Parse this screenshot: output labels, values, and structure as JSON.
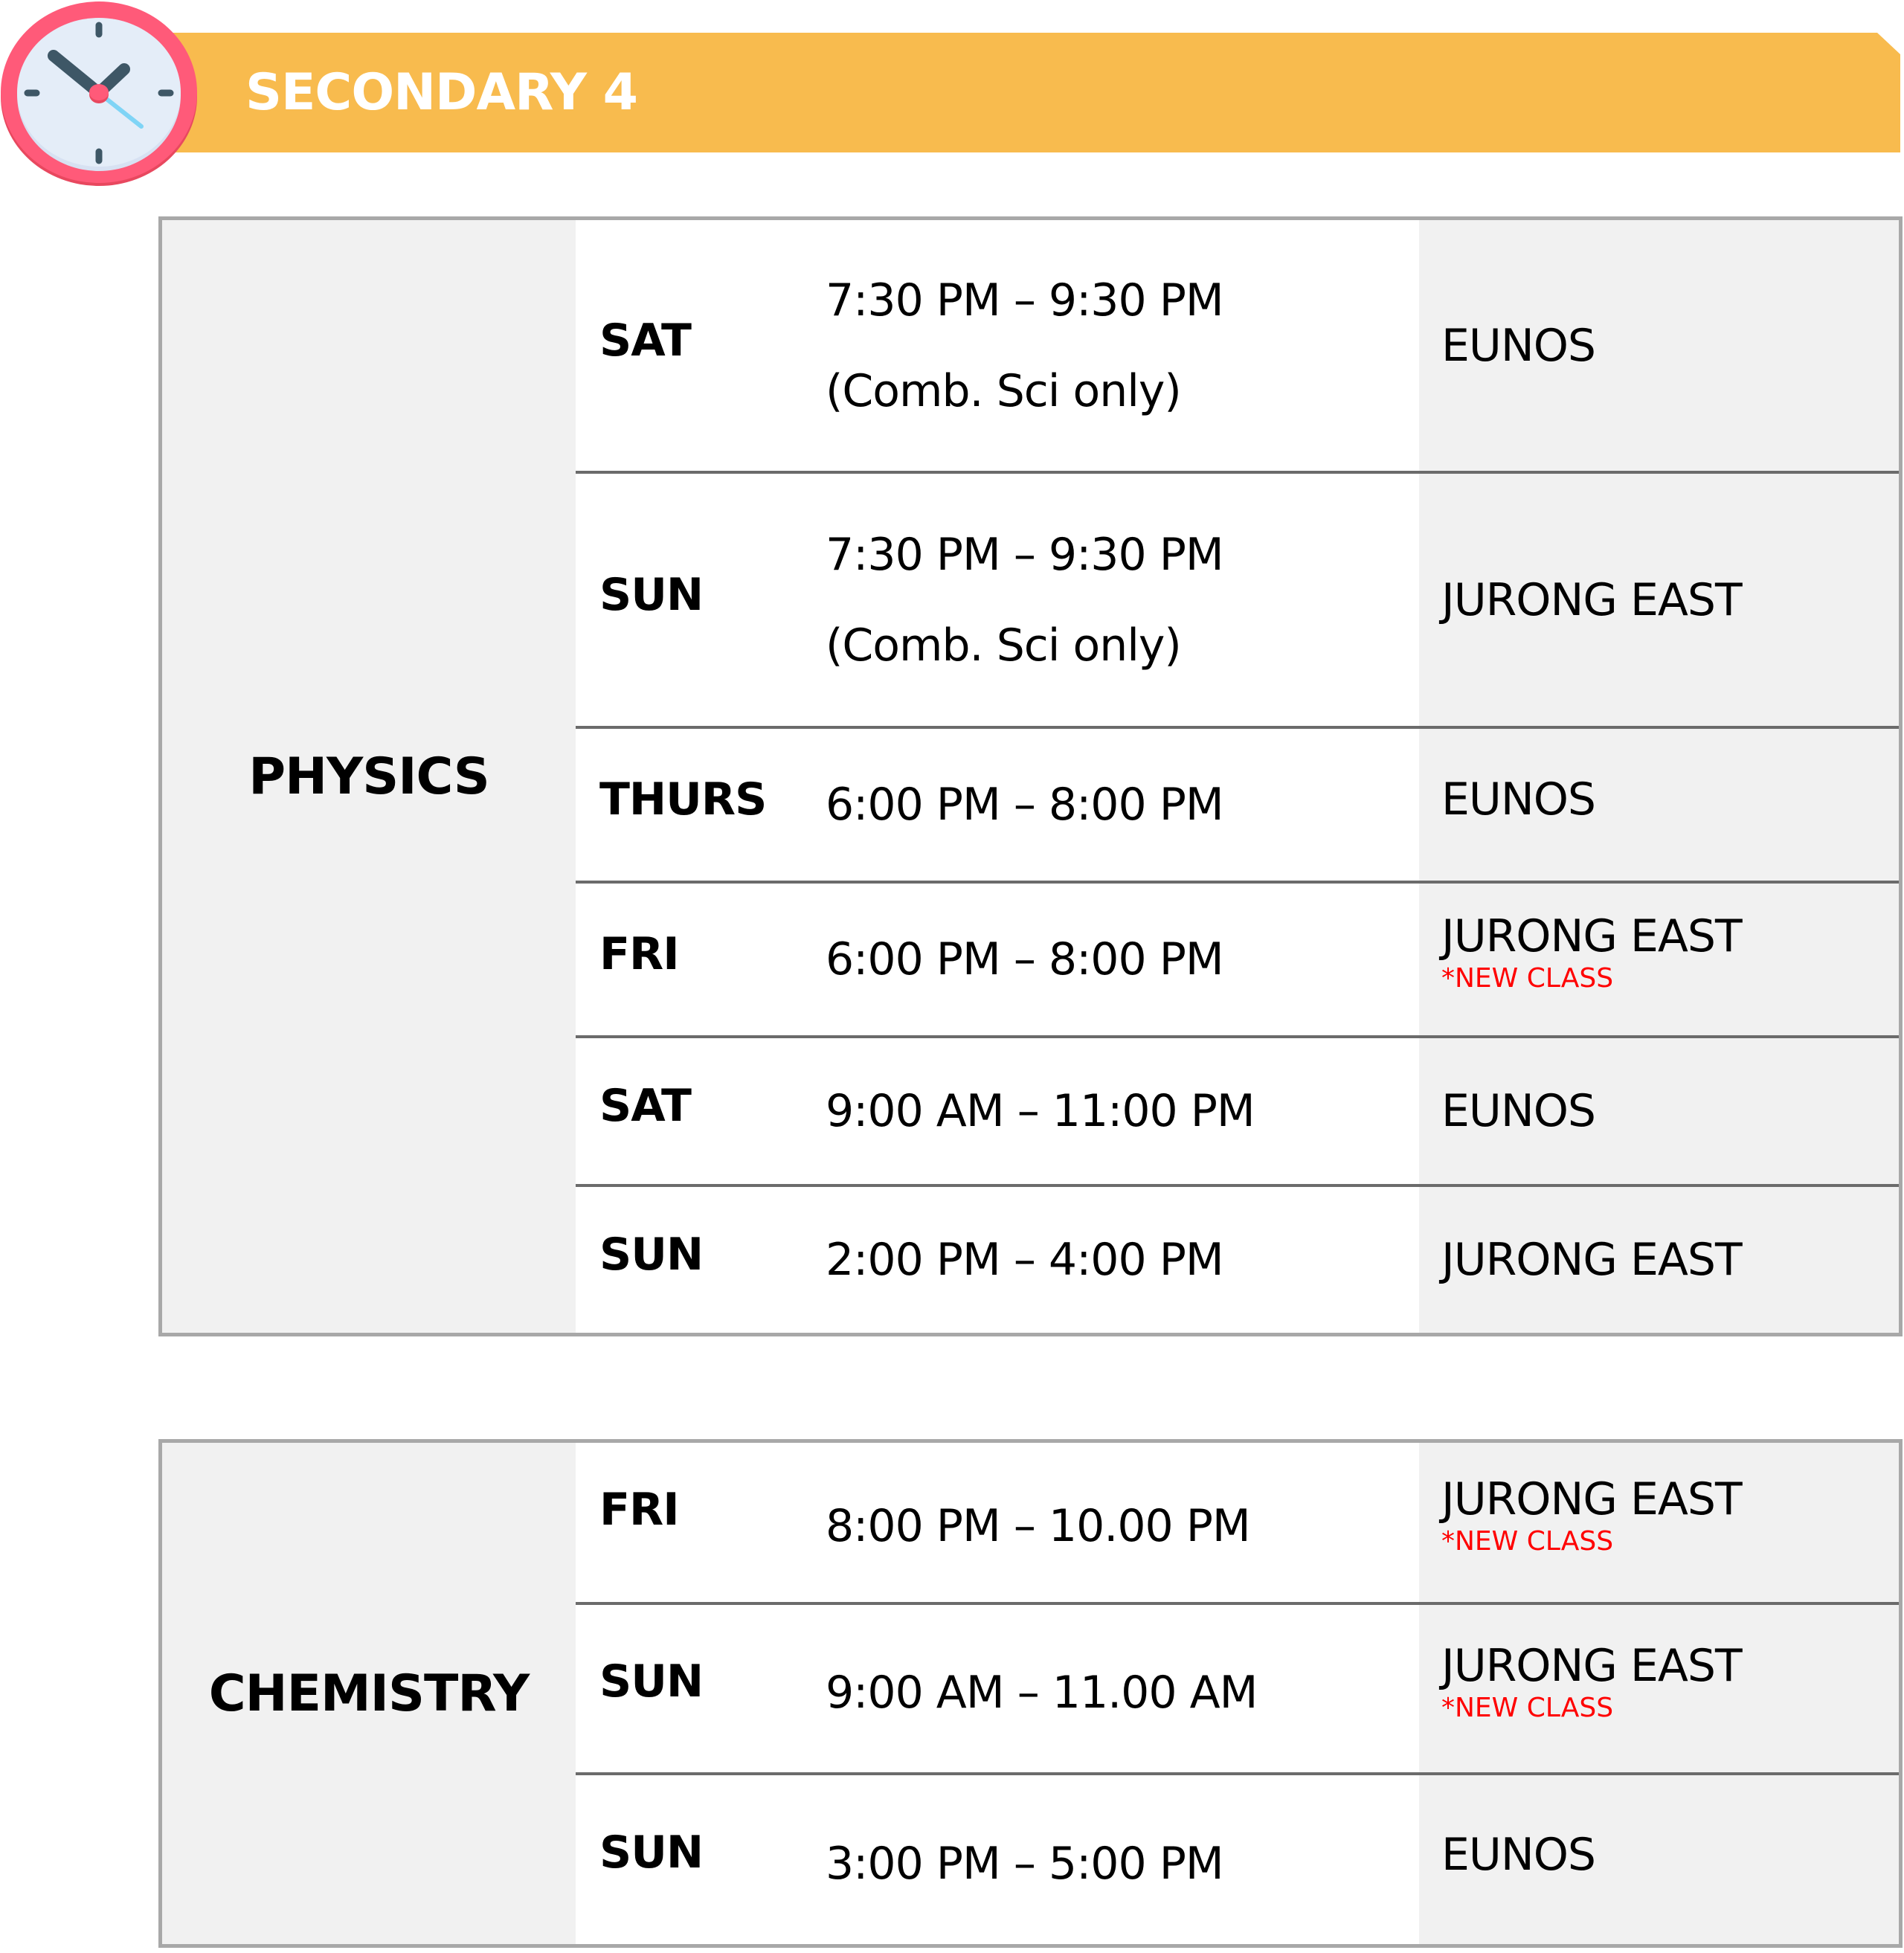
{
  "header": {
    "title": "SECONDARY 4",
    "icon": "clock-icon",
    "banner_color": "#f8bb4e"
  },
  "colors": {
    "note": "#ff0000",
    "cell_gray": "#f1f1f1",
    "border": "#a8a8a8",
    "divider": "#6b6b6b"
  },
  "tables": [
    {
      "subject": "PHYSICS",
      "rows": [
        {
          "day": "SAT",
          "time": "7:30 PM – 9:30 PM",
          "time_note": "(Comb. Sci only)",
          "location": "EUNOS",
          "note": ""
        },
        {
          "day": "SUN",
          "time": "7:30 PM – 9:30 PM",
          "time_note": "(Comb. Sci only)",
          "location": "JURONG EAST",
          "note": ""
        },
        {
          "day": "THURS",
          "time": "6:00 PM – 8:00 PM",
          "time_note": "",
          "location": "EUNOS",
          "note": ""
        },
        {
          "day": "FRI",
          "time": "6:00 PM – 8:00 PM",
          "time_note": "",
          "location": "JURONG EAST",
          "note": "*NEW CLASS"
        },
        {
          "day": "SAT",
          "time": "9:00 AM – 11:00 PM",
          "time_note": "",
          "location": "EUNOS",
          "note": ""
        },
        {
          "day": "SUN",
          "time": "2:00 PM – 4:00 PM",
          "time_note": "",
          "location": "JURONG EAST",
          "note": ""
        }
      ]
    },
    {
      "subject": "CHEMISTRY",
      "rows": [
        {
          "day": "FRI",
          "time": "8:00 PM – 10.00 PM",
          "time_note": "",
          "location": "JURONG EAST",
          "note": "*NEW CLASS"
        },
        {
          "day": "SUN",
          "time": "9:00 AM – 11.00 AM",
          "time_note": "",
          "location": "JURONG EAST",
          "note": "*NEW CLASS"
        },
        {
          "day": "SUN",
          "time": "3:00 PM – 5:00 PM",
          "time_note": "",
          "location": "EUNOS",
          "note": ""
        }
      ]
    }
  ]
}
